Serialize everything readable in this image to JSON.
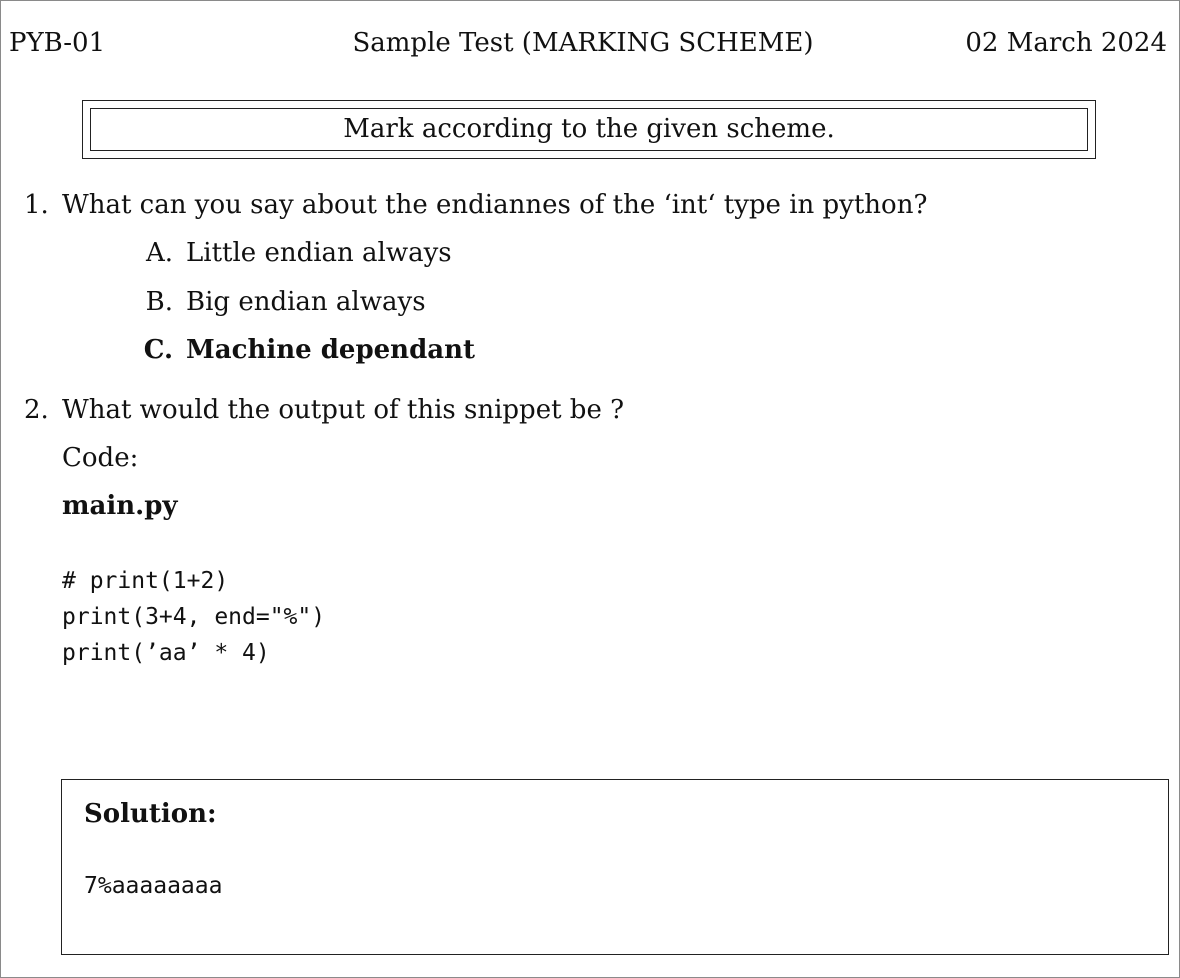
{
  "header": {
    "left": "PYB-01",
    "center": "Sample Test (MARKING SCHEME)",
    "right": "02 March 2024"
  },
  "notice": "Mark according to the given scheme.",
  "question1": {
    "number": "1.",
    "text": "What can you say about the endiannes of the ‘int‘ type in python?",
    "options": [
      {
        "letter": "A.",
        "text": "Little endian always",
        "correct": false
      },
      {
        "letter": "B.",
        "text": "Big endian always",
        "correct": false
      },
      {
        "letter": "C.",
        "text": "Machine dependant",
        "correct": true
      }
    ]
  },
  "question2": {
    "number": "2.",
    "text": "What would the output of this snippet be ?",
    "code_label": "Code:",
    "filename": "main.py",
    "code_lines": [
      "# print(1+2)",
      "print(3+4, end=\"%\")",
      "print(’aa’ * 4)"
    ]
  },
  "solution": {
    "title": "Solution:",
    "answer": "7%aaaaaaaa"
  }
}
